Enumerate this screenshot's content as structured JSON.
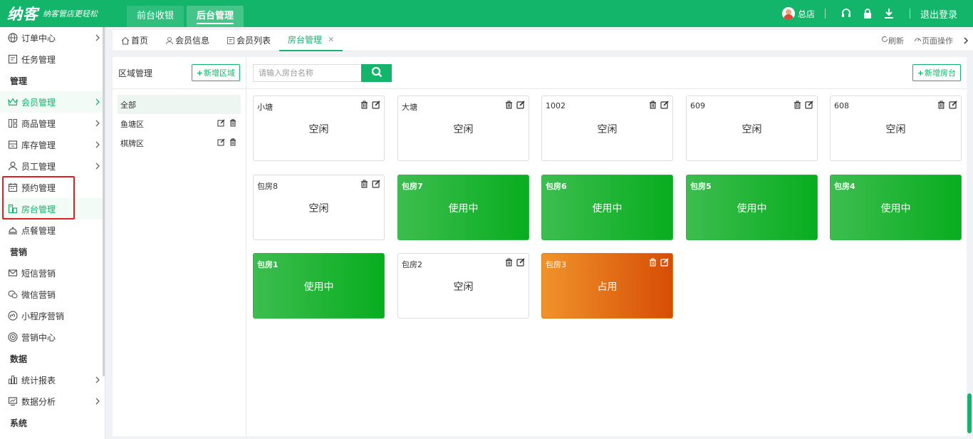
{
  "brand": {
    "logo_text": "纳客",
    "slogan": "纳客管店更轻松",
    "color": "#13b56b"
  },
  "top_tabs": [
    {
      "label": "前台收银"
    },
    {
      "label": "后台管理"
    }
  ],
  "top_right": {
    "user": "总店",
    "logout": "退出登录"
  },
  "sidebar": {
    "items": [
      {
        "label": "订单中心"
      },
      {
        "label": "任务管理"
      },
      {
        "label": "管理"
      },
      {
        "label": "会员管理"
      },
      {
        "label": "商品管理"
      },
      {
        "label": "库存管理"
      },
      {
        "label": "员工管理"
      },
      {
        "label": "预约管理"
      },
      {
        "label": "房台管理"
      },
      {
        "label": "点餐管理"
      },
      {
        "label": "营销"
      },
      {
        "label": "短信营销"
      },
      {
        "label": "微信营销"
      },
      {
        "label": "小程序营销"
      },
      {
        "label": "营销中心"
      },
      {
        "label": "数据"
      },
      {
        "label": "统计报表"
      },
      {
        "label": "数据分析"
      },
      {
        "label": "系统"
      }
    ]
  },
  "tabs": [
    {
      "label": "首页"
    },
    {
      "label": "会员信息"
    },
    {
      "label": "会员列表"
    },
    {
      "label": "房台管理"
    }
  ],
  "tab_actions": {
    "refresh": "刷新",
    "page_ops": "页面操作"
  },
  "area": {
    "title": "区域管理",
    "add_label": "新增区域",
    "items": [
      {
        "label": "全部"
      },
      {
        "label": "鱼塘区"
      },
      {
        "label": "棋牌区"
      }
    ]
  },
  "room": {
    "search_placeholder": "请输入房台名称",
    "add_label": "新增房台",
    "status_colors": {
      "idle": "#ffffff",
      "busy": "#08ad1f",
      "occupied": "#d64d05"
    },
    "cards": [
      {
        "name": "小塘",
        "status": "空闲"
      },
      {
        "name": "大塘",
        "status": "空闲"
      },
      {
        "name": "1002",
        "status": "空闲"
      },
      {
        "name": "609",
        "status": "空闲"
      },
      {
        "name": "608",
        "status": "空闲"
      },
      {
        "name": "包房8",
        "status": "空闲"
      },
      {
        "name": "包房7",
        "status": "使用中"
      },
      {
        "name": "包房6",
        "status": "使用中"
      },
      {
        "name": "包房5",
        "status": "使用中"
      },
      {
        "name": "包房4",
        "status": "使用中"
      },
      {
        "name": "包房1",
        "status": "使用中"
      },
      {
        "name": "包房2",
        "status": "空闲"
      },
      {
        "name": "包房3",
        "status": "占用"
      }
    ]
  }
}
